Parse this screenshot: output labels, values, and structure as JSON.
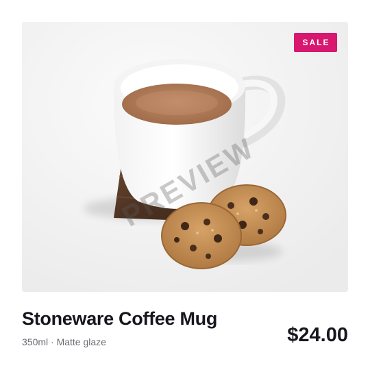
{
  "product": {
    "badge": "SALE",
    "watermark": "PREVIEW",
    "title": "Stoneware Coffee Mug",
    "subtitle": "350ml · Matte glaze",
    "price": "$24.00"
  },
  "colors": {
    "badge_bg": "#d8176f",
    "title_text": "#16161d",
    "muted_text": "#6b6b73",
    "image_bg": "#efefef"
  }
}
